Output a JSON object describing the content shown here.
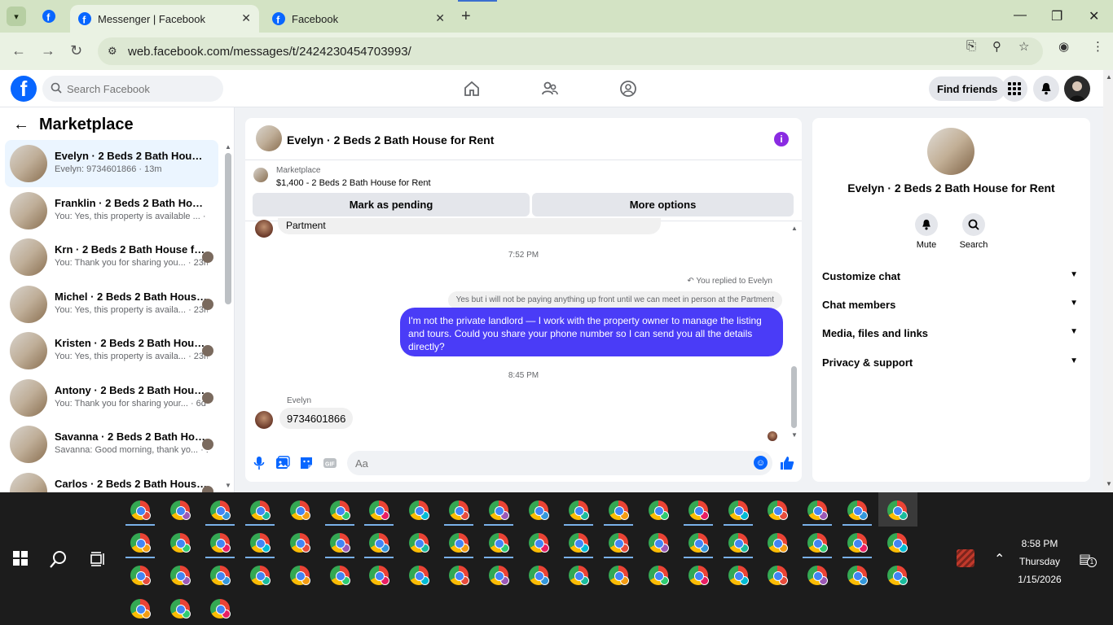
{
  "browser": {
    "tabs": [
      {
        "title": "Messenger | Facebook",
        "active": true
      },
      {
        "title": "Facebook",
        "active": false
      }
    ],
    "url": "web.facebook.com/messages/t/2424230454703993/"
  },
  "fb": {
    "search_placeholder": "Search Facebook",
    "find_friends": "Find friends"
  },
  "sidebar": {
    "title": "Marketplace",
    "conversations": [
      {
        "name": "Evelyn · 2 Beds 2 Bath House fo...",
        "preview": "Evelyn: 9734601866 · 13m",
        "active": true
      },
      {
        "name": "Franklin · 2 Beds 2 Bath House f...",
        "preview": "You: Yes, this property is available ... · 1h"
      },
      {
        "name": "Krn · 2 Beds 2 Bath House for...",
        "preview": "You: Thank you for sharing you... · 23h"
      },
      {
        "name": "Michel · 2 Beds 2 Bath House...",
        "preview": "You: Yes, this property is availa... · 23h"
      },
      {
        "name": "Kristen · 2 Beds 2 Bath House...",
        "preview": "You: Yes, this property is availa... · 23h"
      },
      {
        "name": "Antony · 2 Beds 2 Bath Hous...",
        "preview": "You: Thank you for sharing your... · 6d"
      },
      {
        "name": "Savanna · 2 Beds 2 Bath House ...",
        "preview": "Savanna: Good morning, thank yo... · 1w"
      },
      {
        "name": "Carlos · 2 Beds 2 Bath House ...",
        "preview": ""
      }
    ]
  },
  "chat": {
    "title": "Evelyn · 2 Beds 2 Bath House for Rent",
    "marketplace_label": "Marketplace",
    "listing": "$1,400 - 2 Beds 2 Bath House for Rent",
    "mark_pending": "Mark as pending",
    "more_options": "More options",
    "top_bubble_fragment": "Partment",
    "time1": "7:52 PM",
    "replied_label": "You replied to Evelyn",
    "quoted_text": "Yes but i will not be paying anything up front until we can meet in person at the Partment",
    "my_message": "I'm not the private landlord — I work with the property owner to manage the listing and tours. Could you share your phone number so I can send you all the details directly?",
    "time2": "8:45 PM",
    "sender": "Evelyn",
    "their_message": "9734601866",
    "composer_placeholder": "Aa"
  },
  "rpanel": {
    "name": "Evelyn · 2 Beds 2 Bath House for Rent",
    "mute": "Mute",
    "search": "Search",
    "sections": [
      "Customize chat",
      "Chat members",
      "Media, files and links",
      "Privacy & support"
    ]
  },
  "taskbar": {
    "time": "8:58 PM",
    "day": "Thursday",
    "date": "1/15/2026",
    "notif_count": "1"
  },
  "colors": {
    "fb_blue": "#0866ff",
    "my_bubble": "#4a3cf7",
    "active_conv": "#ebf5ff",
    "tabbar": "#d3e3c4"
  }
}
